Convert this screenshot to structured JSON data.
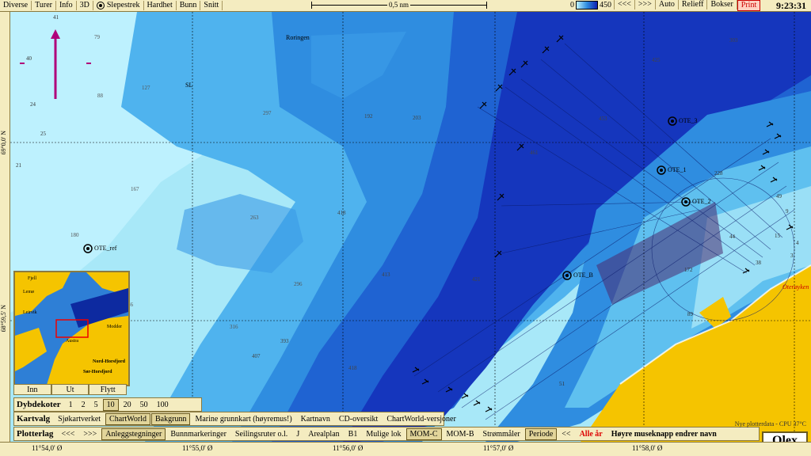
{
  "topbar": {
    "menus": [
      "Diverse",
      "Turer",
      "Info",
      "3D",
      "Slepestrek",
      "Hardhet",
      "Bunn",
      "Snitt"
    ],
    "scale_label": "0,5 nm",
    "depth_min": "0",
    "depth_max": "450",
    "right_buttons": [
      "<<<",
      ">>>",
      "Auto",
      "Relieff",
      "Bokser"
    ],
    "print_label": "Print",
    "clock": "9:23:31"
  },
  "axes": {
    "lat_labels": [
      "69°0,0' N",
      "68°59,5' N"
    ],
    "lon_labels": [
      "11°54,0' Ø",
      "11°55,0' Ø",
      "11°56,0' Ø",
      "11°57,0' Ø",
      "11°58,0' Ø"
    ]
  },
  "map_labels": {
    "place": "Roringen",
    "sl": "SL",
    "oter": "Oterøyken",
    "markers": [
      "OTE_ref",
      "OTE_B",
      "OTE_1",
      "OTE_2",
      "OTE_3"
    ],
    "depths": [
      "41",
      "79",
      "88",
      "127",
      "40",
      "24",
      "25",
      "21",
      "167",
      "180",
      "192",
      "203",
      "303",
      "425",
      "453",
      "461",
      "413",
      "421",
      "418",
      "418",
      "407",
      "393",
      "316",
      "297",
      "263",
      "296",
      "228",
      "172",
      "89",
      "49",
      "38",
      "15",
      "56",
      "36",
      "44",
      "3",
      "9",
      "4",
      "51"
    ]
  },
  "inset": {
    "labels": [
      "Fjell",
      "Lemø",
      "Leirvik",
      "Modder",
      "Nord-Horsfjord",
      "Sør-Horsfjord",
      "Austra"
    ],
    "buttons": [
      "Inn",
      "Ut",
      "Flytt"
    ]
  },
  "dybdekoter": {
    "title": "Dybdekoter",
    "values": [
      "1",
      "2",
      "5",
      "10",
      "20",
      "50",
      "100"
    ],
    "selected": "10"
  },
  "kartvalg": {
    "title": "Kartvalg",
    "items": [
      "Sjøkartverket",
      "ChartWorld",
      "Bakgrunn",
      "Marine grunnkart (høyremus!)",
      "Kartnavn",
      "CD-oversikt",
      "ChartWorld-versjoner"
    ]
  },
  "plotterlag": {
    "title": "Plotterlag",
    "items": [
      "<<<",
      ">>>",
      "Anleggstegninger",
      "Bunnmarkeringer",
      "Seilingsruter o.l.",
      "J",
      "Arealplan",
      "B1",
      "Mulige lok",
      "MOM-C",
      "MOM-B",
      "Strømmåler",
      "Periode",
      "<<"
    ],
    "alle_ar": "Alle år",
    "hint": "Høyre museknapp endrer navn"
  },
  "status_note": "Nye plotterdata - CPU 37°C",
  "brand": "Olex"
}
